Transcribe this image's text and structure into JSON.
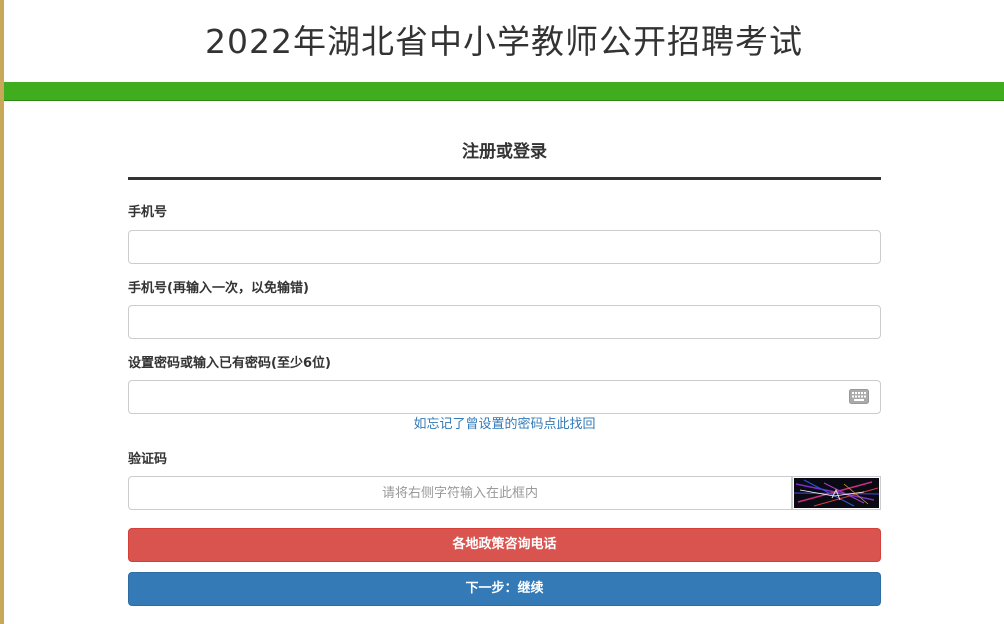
{
  "header": {
    "title": "2022年湖北省中小学教师公开招聘考试"
  },
  "form": {
    "heading": "注册或登录",
    "phone": {
      "label": "手机号",
      "value": ""
    },
    "phone_confirm": {
      "label": "手机号(再输入一次，以免输错)",
      "value": ""
    },
    "password": {
      "label": "设置密码或输入已有密码(至少6位)",
      "value": "",
      "keyboard_icon": "keyboard-icon"
    },
    "forgot_link": "如忘记了曾设置的密码点此找回",
    "captcha": {
      "label": "验证码",
      "placeholder": "请将右侧字符输入在此框内"
    },
    "consult_button": "各地政策咨询电话",
    "next_button": "下一步：继续"
  },
  "colors": {
    "accent_green": "#3fad1e",
    "danger": "#d9534f",
    "primary": "#337ab7",
    "link": "#337ab7",
    "left_edge": "#c8a95a"
  }
}
